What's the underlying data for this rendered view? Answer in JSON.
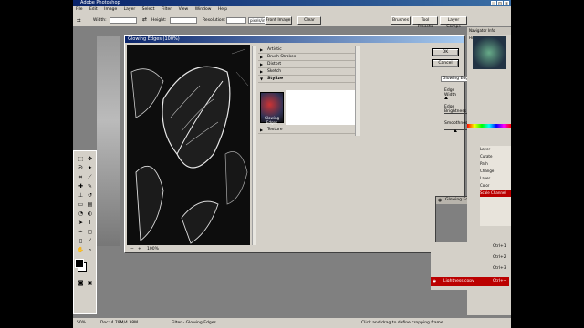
{
  "app": {
    "title": "Adobe Photoshop",
    "window_buttons": [
      "_",
      "□",
      "×"
    ]
  },
  "menu": [
    "File",
    "Edit",
    "Image",
    "Layer",
    "Select",
    "Filter",
    "View",
    "Window",
    "Help"
  ],
  "options": {
    "width_label": "Width:",
    "height_label": "Height:",
    "resolution_label": "Resolution:",
    "units": "pixels/inch",
    "front_image": "Front Image",
    "clear": "Clear",
    "palette_tabs": [
      "Brushes",
      "Tool Presets",
      "Layer Comps"
    ]
  },
  "dialog": {
    "title": "Glowing Edges (100%)",
    "zoom": "100%",
    "ok": "OK",
    "cancel": "Cancel",
    "filter_select": "Glowing Edges",
    "folders": [
      "Artistic",
      "Brush Strokes",
      "Distort",
      "Sketch",
      "Stylize",
      "Texture"
    ],
    "thumb_label": "Glowing Edges",
    "params": [
      {
        "label": "Edge Width",
        "value": "7"
      },
      {
        "label": "Edge Brightness",
        "value": "14"
      },
      {
        "label": "Smoothness",
        "value": "3"
      }
    ],
    "layer_item": "Glowing Edges"
  },
  "dock": {
    "navigator_tabs": "Navigator  Info  Histogram",
    "layer_rows": [
      {
        "name": "Lightness copy",
        "shortcut": "Ctrl+~"
      },
      {
        "name": "",
        "shortcut": "Ctrl+1"
      },
      {
        "name": "",
        "shortcut": "Ctrl+2"
      },
      {
        "name": "",
        "shortcut": "Ctrl+3"
      }
    ],
    "channel_items": [
      "Layer",
      "Curate",
      "Path",
      "Change",
      "Layer",
      "Color",
      "Scale Channel"
    ]
  },
  "status": {
    "zoom": "50%",
    "doc": "Doc: 4.79M/4.38M",
    "filter": "Filter - Glowing Edges",
    "hint": "Click and drag to define cropping frame"
  }
}
